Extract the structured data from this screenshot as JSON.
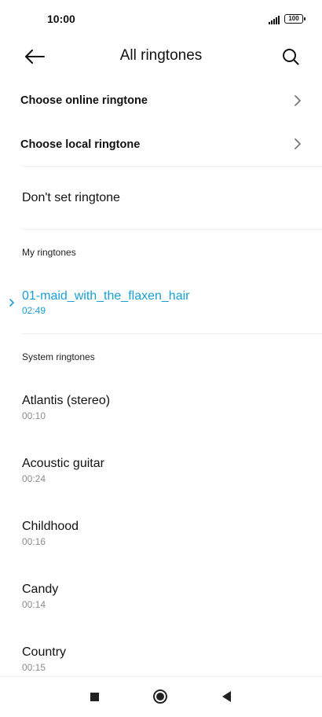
{
  "status": {
    "time": "10:00",
    "battery": "100"
  },
  "header": {
    "title": "All ringtones",
    "back_icon": "arrow-left-icon",
    "search_icon": "search-icon"
  },
  "options": [
    {
      "label": "Choose online ringtone"
    },
    {
      "label": "Choose local ringtone"
    }
  ],
  "no_ringtone": {
    "label": "Don't set ringtone"
  },
  "my_ringtones": {
    "header": "My ringtones",
    "items": [
      {
        "name": "01-maid_with_the_flaxen_hair",
        "duration": "02:49",
        "selected": true
      }
    ]
  },
  "system_ringtones": {
    "header": "System ringtones",
    "items": [
      {
        "name": "Atlantis (stereo)",
        "duration": "00:10"
      },
      {
        "name": "Acoustic guitar",
        "duration": "00:24"
      },
      {
        "name": "Childhood",
        "duration": "00:16"
      },
      {
        "name": "Candy",
        "duration": "00:14"
      },
      {
        "name": "Country",
        "duration": "00:15"
      }
    ]
  },
  "colors": {
    "accent": "#1a9fd6",
    "secondary_text": "#8c8c8c",
    "divider": "#ececec"
  }
}
